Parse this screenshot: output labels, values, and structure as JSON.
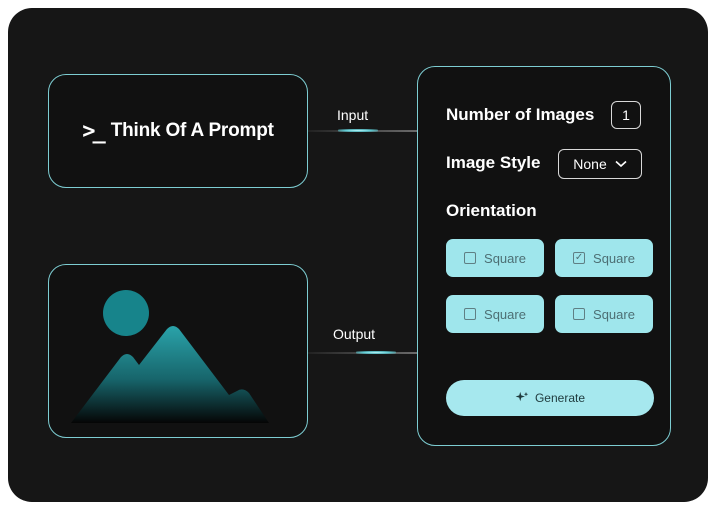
{
  "prompt": {
    "icon": "terminal-prompt-icon",
    "label": "Think Of A Prompt"
  },
  "connectors": {
    "input_label": "Input",
    "output_label": "Output"
  },
  "output_preview": {
    "icon": "image-placeholder-icon"
  },
  "settings": {
    "number_label": "Number of Images",
    "number_value": "1",
    "style_label": "Image Style",
    "style_value": "None",
    "orientation_label": "Orientation",
    "options": [
      {
        "label": "Square",
        "checked": false
      },
      {
        "label": "Square",
        "checked": true
      },
      {
        "label": "Square",
        "checked": false
      },
      {
        "label": "Square",
        "checked": false
      }
    ],
    "generate_label": "Generate"
  },
  "colors": {
    "accent": "#7dcdd2",
    "option_bg": "#9fe6ec",
    "background": "#161616"
  }
}
